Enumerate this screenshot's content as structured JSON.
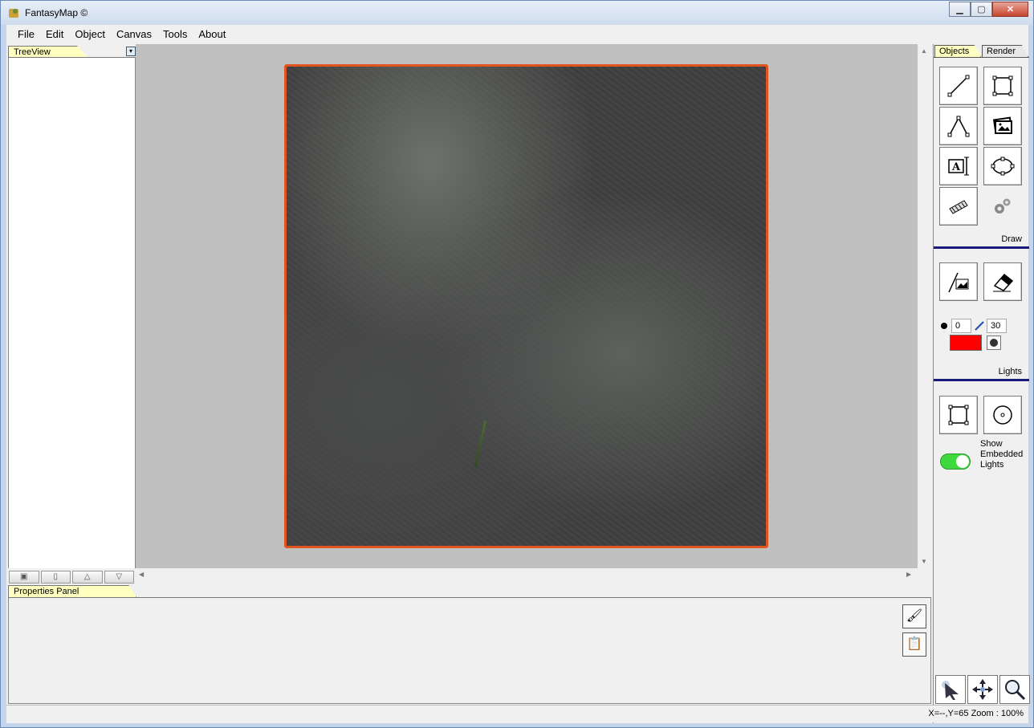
{
  "window": {
    "title": "FantasyMap ©"
  },
  "menu": [
    "File",
    "Edit",
    "Object",
    "Canvas",
    "Tools",
    "About"
  ],
  "treeview": {
    "tab_label": "TreeView"
  },
  "properties": {
    "tab_label": "Properties Panel"
  },
  "right_panel": {
    "tabs": [
      "Objects",
      "Render"
    ],
    "draw_label": "Draw",
    "lights_label": "Lights",
    "brush_size": "0",
    "brush_spread": "30",
    "brush_color": "#ff0000",
    "show_embedded_lights": "Show Embedded Lights",
    "toggle_on": true
  },
  "status": {
    "text": "X=--,Y=65  Zoom : 100%"
  },
  "colors": {
    "map_border": "#e2541e",
    "canvas_bg": "#c0c0c0",
    "separator": "#1a1a7a"
  }
}
